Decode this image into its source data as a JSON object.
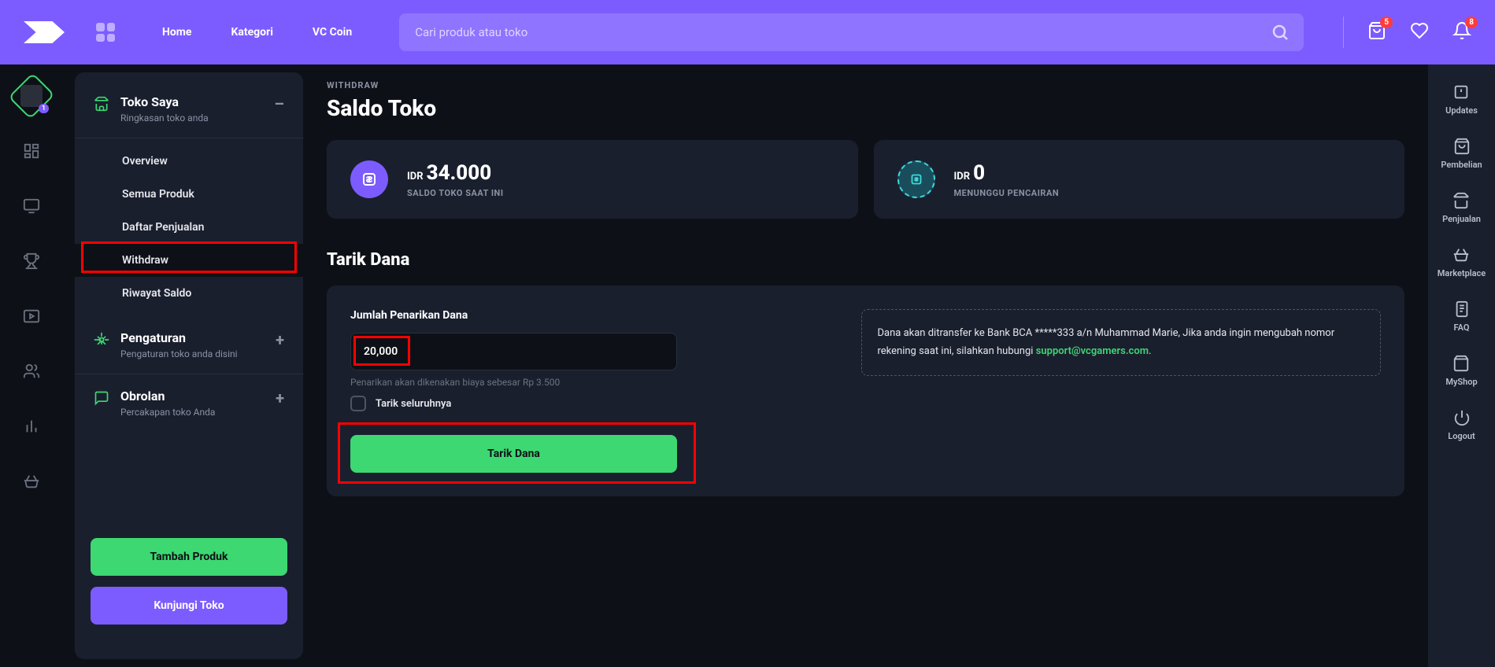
{
  "topbar": {
    "nav": {
      "home": "Home",
      "kategori": "Kategori",
      "vccoin": "VC Coin"
    },
    "search_placeholder": "Cari produk atau toko",
    "cart_badge": "5",
    "bell_badge": "8"
  },
  "left_rail": {
    "avatar_badge": "1"
  },
  "sidebar": {
    "toko": {
      "title": "Toko Saya",
      "sub": "Ringkasan toko anda",
      "toggle": "–"
    },
    "items": {
      "overview": "Overview",
      "semua_produk": "Semua Produk",
      "daftar_penjualan": "Daftar Penjualan",
      "withdraw": "Withdraw",
      "riwayat_saldo": "Riwayat Saldo"
    },
    "pengaturan": {
      "title": "Pengaturan",
      "sub": "Pengaturan toko anda disini",
      "toggle": "+"
    },
    "obrolan": {
      "title": "Obrolan",
      "sub": "Percakapan toko Anda",
      "toggle": "+"
    },
    "btn_tambah": "Tambah Produk",
    "btn_kunjungi": "Kunjungi Toko"
  },
  "content": {
    "breadcrumb": "WITHDRAW",
    "title": "Saldo Toko",
    "card1": {
      "curr": "IDR",
      "amount": "34.000",
      "label": "SALDO TOKO SAAT INI"
    },
    "card2": {
      "curr": "IDR",
      "amount": "0",
      "label": "MENUNGGU PENCAIRAN"
    },
    "section_title": "Tarik Dana",
    "form": {
      "label": "Jumlah Penarikan Dana",
      "value": "20,000",
      "hint": "Penarikan akan dikenakan biaya sebesar Rp 3.500",
      "checkbox": "Tarik seluruhnya",
      "info_text1": "Dana akan ditransfer ke Bank BCA *****333 a/n Muhammad Marie, Jika anda ingin mengubah nomor rekening saat ini, silahkan hubungi ",
      "info_link": "support@vcgamers.com",
      "info_text2": ".",
      "submit": "Tarik Dana"
    }
  },
  "right_rail": {
    "updates": "Updates",
    "pembelian": "Pembelian",
    "penjualan": "Penjualan",
    "marketplace": "Marketplace",
    "faq": "FAQ",
    "myshop": "MyShop",
    "logout": "Logout"
  }
}
